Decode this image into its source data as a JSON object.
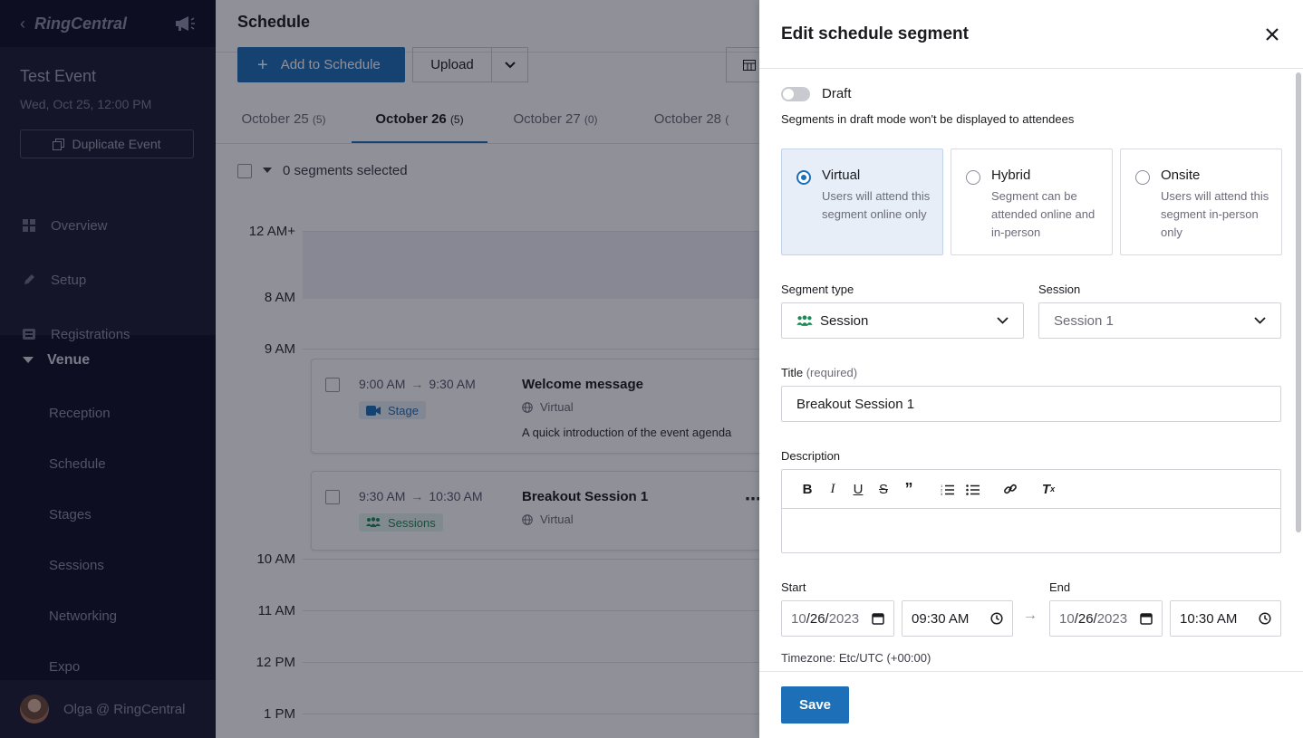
{
  "sidebar": {
    "brand": "RingCentral",
    "event_title": "Test Event",
    "event_date": "Wed, Oct 25, 12:00 PM",
    "duplicate_label": "Duplicate Event",
    "nav": [
      {
        "label": "Overview",
        "icon": "grid-icon"
      },
      {
        "label": "Setup",
        "icon": "pencil-icon"
      },
      {
        "label": "Registrations",
        "icon": "registrations-icon"
      }
    ],
    "venue_label": "Venue",
    "venue_items": [
      "Reception",
      "Schedule",
      "Stages",
      "Sessions",
      "Networking",
      "Expo"
    ],
    "user_name": "Olga @ RingCentral"
  },
  "main": {
    "title": "Schedule",
    "add_label": "Add to Schedule",
    "upload_label": "Upload",
    "tabs": [
      {
        "label": "October 25",
        "count": "(5)"
      },
      {
        "label": "October 26",
        "count": "(5)"
      },
      {
        "label": "October 27",
        "count": "(0)"
      },
      {
        "label": "October 28",
        "count": "("
      }
    ],
    "selected_text": "0 segments selected",
    "time_labels": [
      "12 AM+",
      "8 AM",
      "9 AM",
      "10 AM",
      "11 AM",
      "12 PM",
      "1 PM"
    ],
    "cards": [
      {
        "start": "9:00 AM",
        "end": "9:30 AM",
        "badge": "Stage",
        "title": "Welcome message",
        "location": "Virtual",
        "description": "A quick introduction of the event agenda"
      },
      {
        "start": "9:30 AM",
        "end": "10:30 AM",
        "badge": "Sessions",
        "title": "Breakout Session 1",
        "location": "Virtual",
        "description": ""
      }
    ]
  },
  "drawer": {
    "title": "Edit schedule segment",
    "draft_label": "Draft",
    "draft_note": "Segments in draft mode won't be displayed to attendees",
    "modes": [
      {
        "title": "Virtual",
        "desc": "Users will attend this segment online only",
        "selected": true
      },
      {
        "title": "Hybrid",
        "desc": "Segment can be attended online and in-person",
        "selected": false
      },
      {
        "title": "Onsite",
        "desc": "Users will attend this segment in-person only",
        "selected": false
      }
    ],
    "segment_type_label": "Segment type",
    "segment_type_value": "Session",
    "session_label": "Session",
    "session_value": "Session 1",
    "title_label": "Title",
    "title_required": "(required)",
    "title_value": "Breakout Session 1",
    "description_label": "Description",
    "start_label": "Start",
    "end_label": "End",
    "start_date": {
      "m": "10",
      "d": "26",
      "y": "2023"
    },
    "start_time": {
      "h": "09",
      "min": "30",
      "ampm": "AM"
    },
    "end_date": {
      "m": "10",
      "d": "26",
      "y": "2023"
    },
    "end_time": {
      "h": "10",
      "min": "30",
      "ampm": "AM"
    },
    "timezone": "Timezone: Etc/UTC (+00:00)",
    "save_label": "Save"
  },
  "colors": {
    "primary": "#1d6fb8",
    "sidebar_bg": "#0e0f24",
    "sessions_green": "#1f8a58"
  }
}
